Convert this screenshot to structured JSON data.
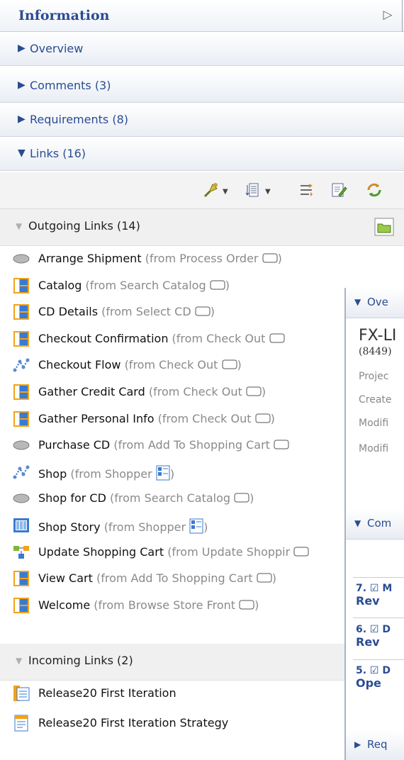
{
  "panel": {
    "title": "Information",
    "collapse_glyph": "▷"
  },
  "sections": [
    {
      "label": "Overview",
      "expanded": false
    },
    {
      "label": "Comments (3)",
      "expanded": false
    },
    {
      "label": "Requirements (8)",
      "expanded": false
    },
    {
      "label": "Links (16)",
      "expanded": true
    }
  ],
  "toolbar": {
    "buttons": [
      "add-link-icon",
      "sort-icon",
      "filter-icon",
      "edit-icon",
      "refresh-icon"
    ]
  },
  "outgoing": {
    "label": "Outgoing Links (14)",
    "items": [
      {
        "icon": "ellipse-icon",
        "name": "Arrange Shipment",
        "from": "(from Process Order",
        "tail": ")"
      },
      {
        "icon": "storyboard-icon",
        "name": "Catalog",
        "from": "(from Search Catalog",
        "tail": ")"
      },
      {
        "icon": "storyboard-icon",
        "name": "CD Details",
        "from": "(from Select CD",
        "tail": ")"
      },
      {
        "icon": "storyboard-icon",
        "name": "Checkout Confirmation",
        "from": "(from Check Out",
        "tail": ""
      },
      {
        "icon": "flow-icon",
        "name": "Checkout Flow",
        "from": "(from Check Out",
        "tail": ")"
      },
      {
        "icon": "storyboard-icon",
        "name": "Gather Credit Card",
        "from": "(from Check Out",
        "tail": ")"
      },
      {
        "icon": "storyboard-icon",
        "name": "Gather Personal Info",
        "from": "(from Check Out",
        "tail": ")"
      },
      {
        "icon": "ellipse-icon",
        "name": "Purchase CD",
        "from": "(from Add To Shopping Cart",
        "tail": ""
      },
      {
        "icon": "flow-icon",
        "name": "Shop",
        "from": "(from Shopper",
        "tail": ")"
      },
      {
        "icon": "ellipse-icon",
        "name": "Shop for CD",
        "from": "(from Search Catalog",
        "tail": ")"
      },
      {
        "icon": "story-icon",
        "name": "Shop Story",
        "from": "(from Shopper",
        "tail": ")"
      },
      {
        "icon": "process-icon",
        "name": "Update Shopping Cart",
        "from": "(from Update Shoppir",
        "tail": ""
      },
      {
        "icon": "storyboard-icon",
        "name": "View Cart",
        "from": "(from Add To Shopping Cart",
        "tail": ")"
      },
      {
        "icon": "storyboard-icon",
        "name": "Welcome",
        "from": "(from Browse Store Front",
        "tail": ")"
      }
    ]
  },
  "incoming": {
    "label": "Incoming Links (2)",
    "items": [
      {
        "icon": "iteration-icon",
        "name": "Release20 First Iteration"
      },
      {
        "icon": "document-icon",
        "name": "Release20 First Iteration Strategy"
      }
    ]
  },
  "overlay": {
    "header1": "Ove",
    "title": "FX-LI",
    "sub": "(8449)",
    "fields": [
      "Projec",
      "Create",
      "Modifi",
      "Modifi"
    ],
    "header2": "Com",
    "items": [
      {
        "num": "7.",
        "tag": "M",
        "line2": "Rev"
      },
      {
        "num": "6.",
        "tag": "D",
        "line2": "Rev"
      },
      {
        "num": "5.",
        "tag": "D",
        "line2": "Ope"
      }
    ],
    "header3": "Req"
  },
  "colors": {
    "accent": "#2a4c93",
    "muted": "#8a8a8a"
  }
}
